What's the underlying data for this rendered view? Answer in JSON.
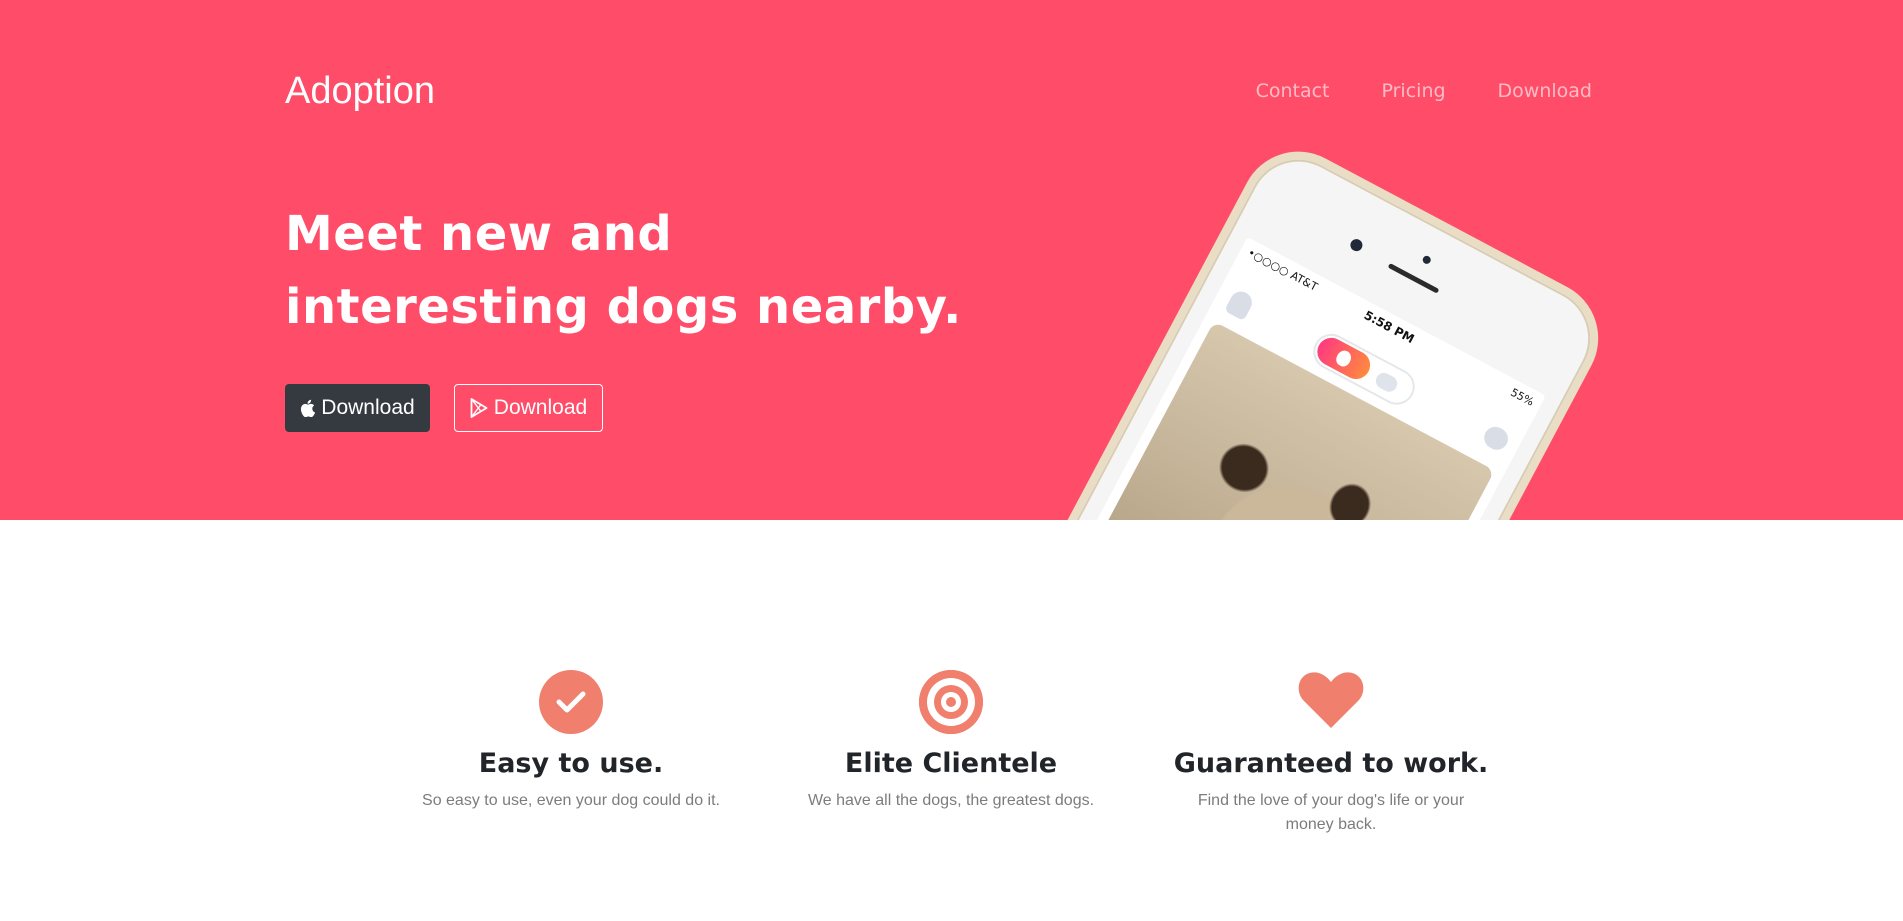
{
  "colors": {
    "hero_bg": "#ff4c68",
    "accent": "#f07f6d",
    "dark_button": "#343a40"
  },
  "navbar": {
    "brand": "Adoption",
    "links": [
      "Contact",
      "Pricing",
      "Download"
    ]
  },
  "hero": {
    "headline": "Meet new and interesting dogs nearby.",
    "buttons": [
      {
        "label": "Download",
        "icon": "apple-icon"
      },
      {
        "label": "Download",
        "icon": "google-play-icon"
      }
    ],
    "phone": {
      "carrier": "•○○○○ AT&T",
      "time": "5:58 PM",
      "battery": "55%"
    }
  },
  "features": [
    {
      "icon": "check-circle-icon",
      "title": "Easy to use.",
      "text": "So easy to use, even your dog could do it."
    },
    {
      "icon": "target-icon",
      "title": "Elite Clientele",
      "text": "We have all the dogs, the greatest dogs."
    },
    {
      "icon": "heart-icon",
      "title": "Guaranteed to work.",
      "text": "Find the love of your dog's life or your money back."
    }
  ]
}
